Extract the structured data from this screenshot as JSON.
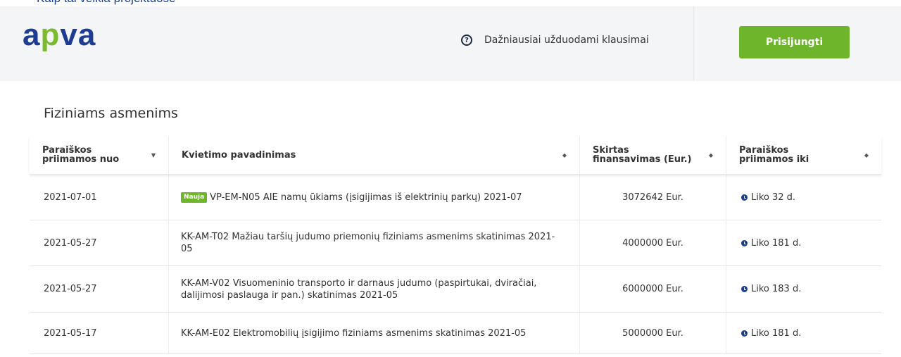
{
  "top_strip": {
    "text": "Kaip tai veikia projektuose"
  },
  "header": {
    "logo": {
      "part1": "a",
      "part2": "p",
      "part3": "va"
    },
    "faq_label": "Dažniausiai užduodami klausimai",
    "faq_icon": "question-circle-icon",
    "login_label": "Prisijungti"
  },
  "section": {
    "title": "Fiziniams asmenims"
  },
  "table": {
    "headers": [
      {
        "label": "Paraiškos\npriimamos nuo",
        "sort": "▼"
      },
      {
        "label": "Kvietimo pavadinimas",
        "sort": "◆"
      },
      {
        "label": "Skirtas\nfinansavimas (Eur.)",
        "sort": "◆"
      },
      {
        "label": "Paraiškos\npriimamos iki",
        "sort": "◆"
      }
    ],
    "rows": [
      {
        "date": "2021-07-01",
        "badge": "Nauja",
        "name": "VP-EM-N05 AIE namų ūkiams (įsigijimas iš elektrinių parkų) 2021-07",
        "amount": "3072642 Eur.",
        "deadline": "Liko 32 d."
      },
      {
        "date": "2021-05-27",
        "badge": "",
        "name": "KK-AM-T02 Mažiau taršių judumo priemonių fiziniams asmenims skatinimas 2021-05",
        "amount": "4000000 Eur.",
        "deadline": "Liko 181 d."
      },
      {
        "date": "2021-05-27",
        "badge": "",
        "name": "KK-AM-V02 Visuomeninio transporto ir darnaus judumo (paspirtukai, dviračiai, dalijimosi paslauga ir pan.) skatinimas 2021-05",
        "amount": "6000000 Eur.",
        "deadline": "Liko 183 d."
      },
      {
        "date": "2021-05-17",
        "badge": "",
        "name": "KK-AM-E02 Elektromobilių įsigijimo fiziniams asmenims skatinimas 2021-05",
        "amount": "5000000 Eur.",
        "deadline": "Liko 181 d."
      }
    ]
  },
  "colors": {
    "brand_blue": "#1e3c91",
    "brand_green": "#7cba2f",
    "button_green": "#6fb52c"
  }
}
